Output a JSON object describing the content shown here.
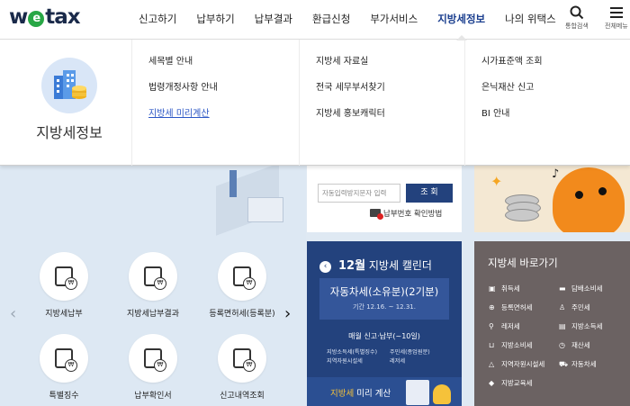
{
  "logo": {
    "pre": "w",
    "e": "e",
    "post": "tax"
  },
  "nav": [
    {
      "label": "신고하기"
    },
    {
      "label": "납부하기"
    },
    {
      "label": "납부결과"
    },
    {
      "label": "환급신청"
    },
    {
      "label": "부가서비스"
    },
    {
      "label": "지방세정보"
    },
    {
      "label": "나의 위택스"
    }
  ],
  "util": {
    "search_icon": "search-icon",
    "search_label": "통합검색",
    "menu_icon": "menu-icon",
    "menu_label": "전체메뉴"
  },
  "mega": {
    "title": "지방세정보",
    "icon": "city-coins-icon",
    "col1": [
      "세목별 안내",
      "법령개정사항 안내",
      "지방세 미리계산"
    ],
    "col2": [
      "지방세 자료실",
      "전국 세무부서찾기",
      "지방세 홍보캐릭터"
    ],
    "col3": [
      "시가표준액 조회",
      "은닉재산 신고",
      "BI 안내"
    ],
    "highlighted": "지방세 미리계산"
  },
  "search": {
    "placeholder": "자동입력방지문자 입력",
    "button": "조 회",
    "link": "납부번호 확인방법"
  },
  "calendar": {
    "month": "12월",
    "title": "지방세 캘린더",
    "tax_name": "자동차세(소유분)(2기분)",
    "period": "기간 12.16. ~ 12.31.",
    "due": "매월 신고·납부(~10일)",
    "items": [
      "지방소득세(특별징수)",
      "주민세(종업원분)",
      "지역자원시설세",
      "레저세"
    ],
    "preview_pre": "지방세",
    "preview_post": " 미리 계산"
  },
  "shortcuts": {
    "title": "지방세 바로가기",
    "items": [
      "취득세",
      "담배소비세",
      "등록면허세",
      "주민세",
      "레저세",
      "지방소득세",
      "지방소비세",
      "재산세",
      "지역자원시설세",
      "자동차세",
      "지방교육세"
    ]
  },
  "quick": [
    {
      "label": "지방세납부"
    },
    {
      "label": "지방세납부결과"
    },
    {
      "label": "등록면허세(등록분)"
    },
    {
      "label": "특별징수"
    },
    {
      "label": "납부확인서"
    },
    {
      "label": "신고내역조회"
    }
  ],
  "colors": {
    "brand_navy": "#23427d",
    "accent_blue": "#2b56c5",
    "shortcut_bg": "#6b6262",
    "logo_green": "#28a745"
  }
}
